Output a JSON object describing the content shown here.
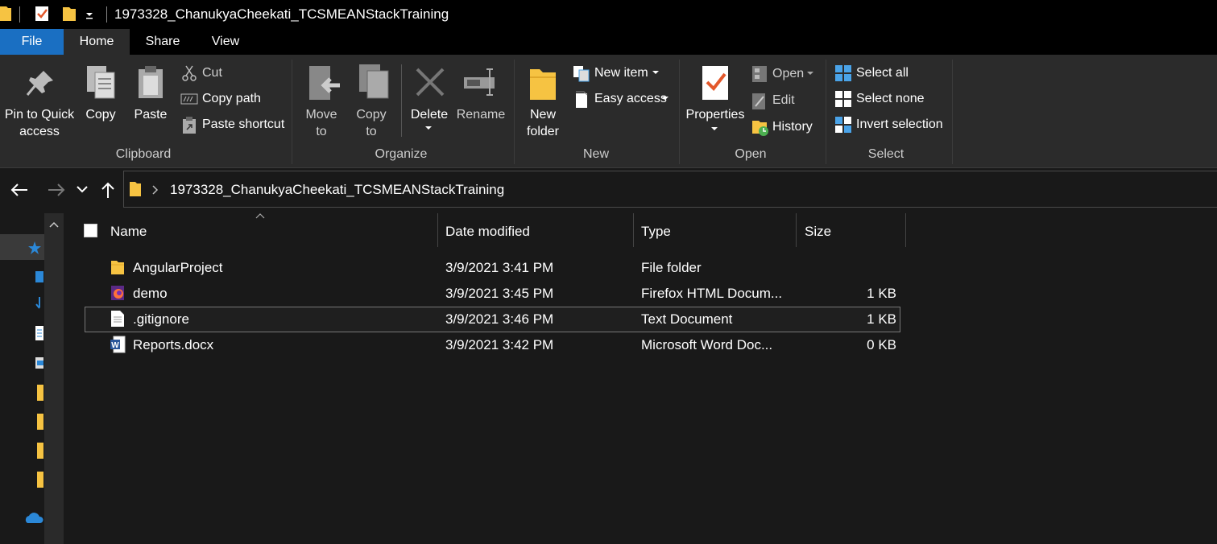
{
  "window": {
    "title": "1973328_ChanukyaCheekati_TCSMEANStackTraining"
  },
  "ribbon_tabs": {
    "file": "File",
    "home": "Home",
    "share": "Share",
    "view": "View"
  },
  "clipboard": {
    "pin_line1": "Pin to Quick",
    "pin_line2": "access",
    "copy": "Copy",
    "paste": "Paste",
    "cut": "Cut",
    "copy_path": "Copy path",
    "paste_shortcut": "Paste shortcut",
    "label": "Clipboard"
  },
  "organize": {
    "move_line1": "Move",
    "move_line2": "to",
    "copyto_line1": "Copy",
    "copyto_line2": "to",
    "delete": "Delete",
    "rename": "Rename",
    "label": "Organize"
  },
  "new": {
    "new_item": "New item",
    "easy_access": "Easy access",
    "new_folder_line1": "New",
    "new_folder_line2": "folder",
    "label": "New"
  },
  "open": {
    "properties": "Properties",
    "open": "Open",
    "edit": "Edit",
    "history": "History",
    "label": "Open"
  },
  "select": {
    "select_all": "Select all",
    "select_none": "Select none",
    "invert_selection": "Invert selection",
    "label": "Select"
  },
  "address": {
    "path": "1973328_ChanukyaCheekati_TCSMEANStackTraining"
  },
  "columns": {
    "name": "Name",
    "date_modified": "Date modified",
    "type": "Type",
    "size": "Size"
  },
  "files": [
    {
      "name": "AngularProject",
      "date": "3/9/2021 3:41 PM",
      "type": "File folder",
      "size": "",
      "icon": "folder-icon"
    },
    {
      "name": "demo",
      "date": "3/9/2021 3:45 PM",
      "type": "Firefox HTML Docum...",
      "size": "1 KB",
      "icon": "firefox-icon"
    },
    {
      "name": ".gitignore",
      "date": "3/9/2021 3:46 PM",
      "type": "Text Document",
      "size": "1 KB",
      "icon": "text-file-icon"
    },
    {
      "name": "Reports.docx",
      "date": "3/9/2021 3:42 PM",
      "type": "Microsoft Word Doc...",
      "size": "0 KB",
      "icon": "word-icon"
    }
  ],
  "colors": {
    "file_tab": "#1a6fc2",
    "ribbon_bg": "#2b2b2b",
    "window_bg": "#191919",
    "folder": "#f6c342"
  }
}
